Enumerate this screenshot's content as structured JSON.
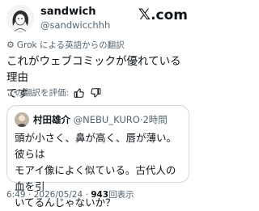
{
  "author": {
    "name": "sandwich",
    "handle": "@sandwicchhh"
  },
  "brand": {
    "text": ".com",
    "x_glyph": "𝕏"
  },
  "translation_notice": "Grok による英語からの翻訳",
  "tweet_text": "これがウェブコミックが優れている理由\nです",
  "rate_translation": "この翻訳を評価:",
  "quoted": {
    "name": "村田雄介",
    "handle": "@NEBU_KURO",
    "time": "2時間",
    "text": "頭が小さく、鼻が高く、唇が薄い。彼らは\nモアイ像によく似ている。古代人の血を引\nいてるんじゃないか？"
  },
  "meta": {
    "time": "6:49",
    "date": "2026/05/24",
    "views_count": "943",
    "views_label": "回表示"
  },
  "icons": [
    "grok-translate-icon",
    "thumbs-up-icon",
    "thumbs-down-icon"
  ]
}
